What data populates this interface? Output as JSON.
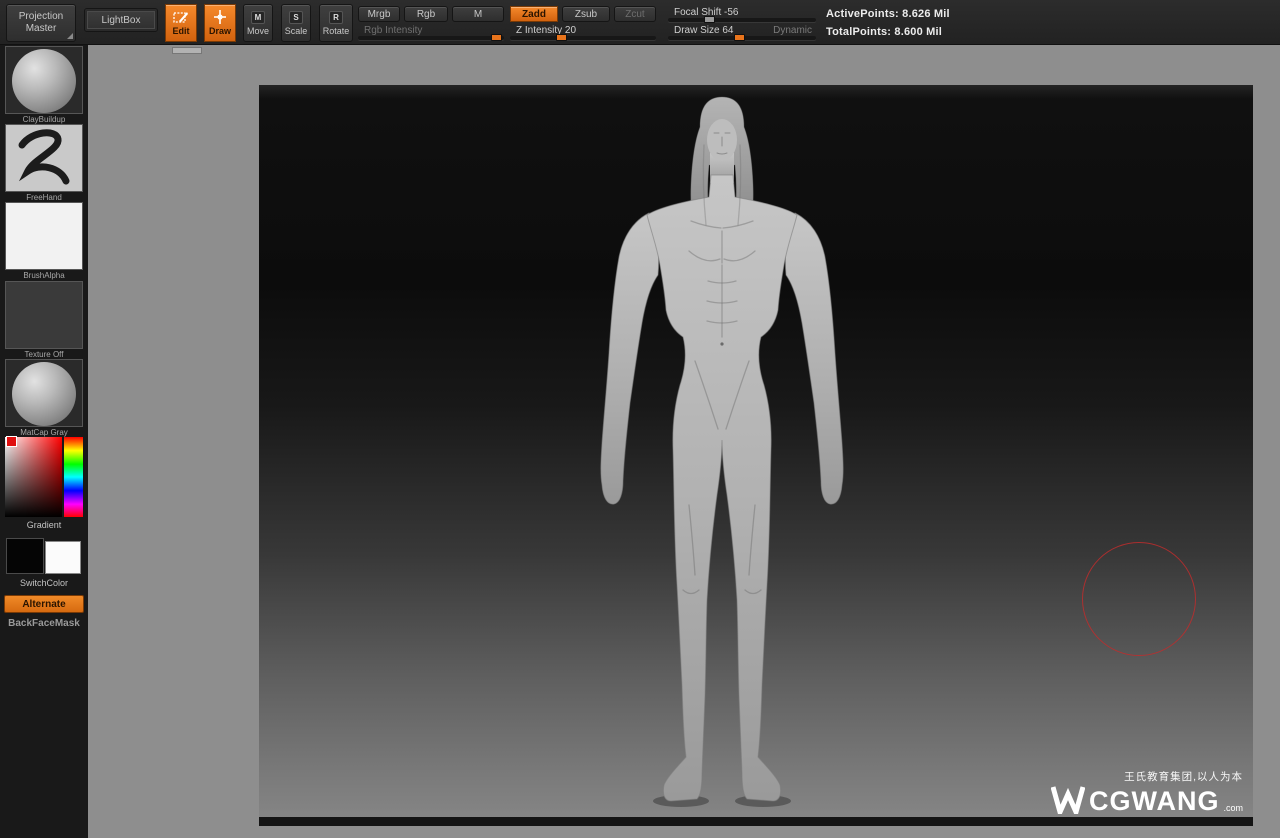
{
  "topbar": {
    "projection_master_line1": "Projection",
    "projection_master_line2": "Master",
    "lightbox": "LightBox",
    "edit": "Edit",
    "draw": "Draw",
    "move": "Move",
    "scale": "Scale",
    "rotate": "Rotate",
    "move_icon": "M",
    "scale_icon": "S",
    "rotate_icon": "R",
    "mrgb": "Mrgb",
    "rgb": "Rgb",
    "m": "M",
    "zadd": "Zadd",
    "zsub": "Zsub",
    "zcut": "Zcut",
    "rgb_intensity": "Rgb Intensity",
    "z_intensity": "Z Intensity 20",
    "focal_shift": "Focal Shift -56",
    "draw_size": "Draw Size 64",
    "dynamic": "Dynamic",
    "active_points": "ActivePoints: 8.626 Mil",
    "total_points": "TotalPoints: 8.600 Mil"
  },
  "sidebar": {
    "brushes": [
      {
        "label": "ClayBuildup"
      },
      {
        "label": "FreeHand"
      },
      {
        "label": "BrushAlpha"
      },
      {
        "label": "Texture Off"
      },
      {
        "label": "MatCap Gray"
      }
    ],
    "gradient_label": "Gradient",
    "switchcolor_label": "SwitchColor",
    "alternate": "Alternate",
    "backfacemask": "BackFaceMask"
  },
  "canvas": {
    "watermark_cn": "王氏教育集团,以人为本",
    "watermark_brand": "CGWANG",
    "watermark_suffix": ".com"
  },
  "colors": {
    "accent_orange": "#e8741c",
    "cursor_red": "#be2d2d",
    "current_color": "#e01010"
  }
}
